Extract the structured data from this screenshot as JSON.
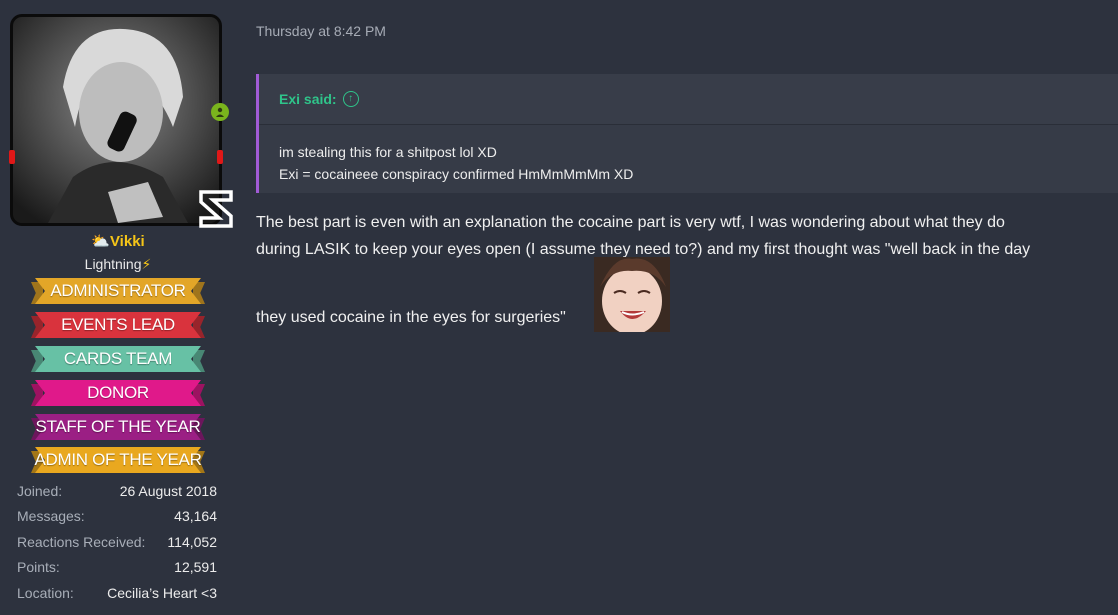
{
  "user": {
    "name": "Vikki",
    "title": "Lightning",
    "title_emoji": "⚡",
    "name_icon": "sun-cloud-icon",
    "banners": [
      {
        "label": "ADMINISTRATOR",
        "color": "#e3a628"
      },
      {
        "label": "EVENTS LEAD",
        "color": "#d9333d"
      },
      {
        "label": "CARDS TEAM",
        "color": "#67c1a5"
      },
      {
        "label": "DONOR",
        "color": "#e0198a"
      },
      {
        "label": "STAFF OF THE YEAR",
        "color": "#9b1f84"
      },
      {
        "label": "ADMIN OF THE YEAR",
        "color": "#e9a81f"
      }
    ],
    "stats": [
      {
        "key": "Joined:",
        "value": "26 August 2018"
      },
      {
        "key": "Messages:",
        "value": "43,164"
      },
      {
        "key": "Reactions Received:",
        "value": "114,052"
      },
      {
        "key": "Points:",
        "value": "12,591"
      },
      {
        "key": "Location:",
        "value": "Cecilia’s Heart <3"
      }
    ]
  },
  "post": {
    "timestamp": "Thursday at 8:42 PM",
    "quote": {
      "author": "Exi said:",
      "lines": [
        "im stealing this for a shitpost lol XD",
        "Exi = cocaineee conspiracy confirmed HmMmMmMm XD"
      ]
    },
    "body_lines": [
      "The best part is even with an explanation the cocaine part is very wtf, I was wondering about what they do",
      "during LASIK to keep your eyes open (I assume they need to?) and my first thought was \"well back in the day",
      "they used cocaine in the eyes for surgeries\""
    ]
  },
  "colors": {
    "background": "#2d323e",
    "quote_bg": "#363b47",
    "quote_accent": "#a15bd6",
    "quote_author": "#2fc48a",
    "username": "#f5c518",
    "online": "#7ab51d"
  }
}
